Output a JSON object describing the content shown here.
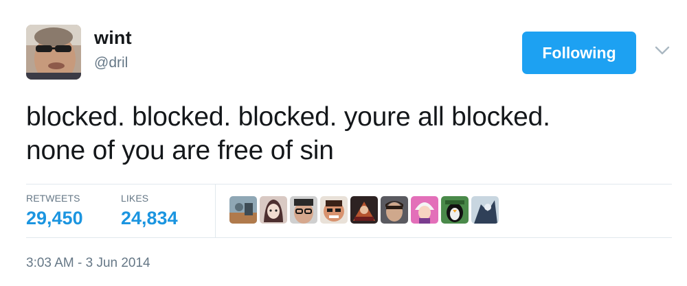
{
  "user": {
    "name": "wint",
    "handle": "@dril"
  },
  "follow_button": {
    "label": "Following",
    "color": "#1da1f2"
  },
  "tweet": {
    "line1": "blocked. blocked. blocked. youre all blocked.",
    "line2": "none of you are free of sin"
  },
  "stats": {
    "retweets_label": "RETWEETS",
    "retweets_count": "29,450",
    "likes_label": "LIKES",
    "likes_count": "24,834"
  },
  "likers_count_shown": 9,
  "timestamp": "3:03 AM - 3 Jun 2014",
  "colors": {
    "accent": "#1b95e0",
    "secondary_text": "#657786",
    "primary_text": "#14171a",
    "divider": "#e1e8ed"
  },
  "icons": {
    "caret": "chevron-down-icon"
  }
}
